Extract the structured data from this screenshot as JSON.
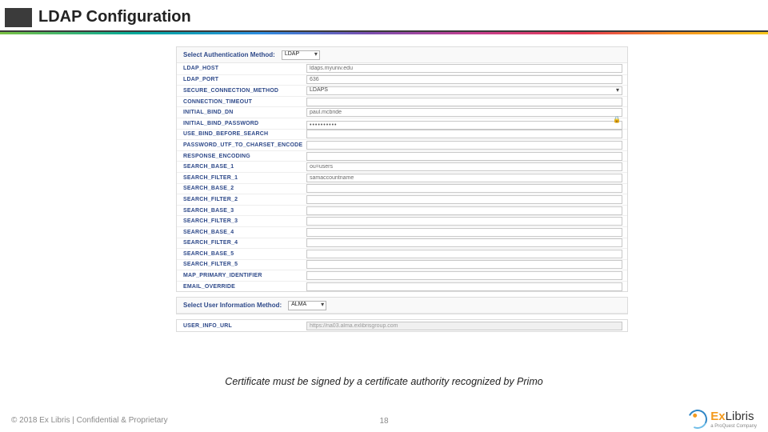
{
  "header": {
    "title": "LDAP Configuration"
  },
  "authMethod": {
    "label": "Select Authentication Method:",
    "value": "LDAP"
  },
  "rows": [
    {
      "label": "LDAP_HOST",
      "type": "text",
      "value": "ldaps.myuniv.edu"
    },
    {
      "label": "LDAP_PORT",
      "type": "text",
      "value": "636"
    },
    {
      "label": "SECURE_CONNECTION_METHOD",
      "type": "select",
      "value": "LDAPS"
    },
    {
      "label": "CONNECTION_TIMEOUT",
      "type": "text",
      "value": ""
    },
    {
      "label": "INITIAL_BIND_DN",
      "type": "text",
      "value": "paul.mcbride"
    },
    {
      "label": "INITIAL_BIND_PASSWORD",
      "type": "password",
      "value": "••••••••••"
    },
    {
      "label": "USE_BIND_BEFORE_SEARCH",
      "type": "text",
      "value": ""
    },
    {
      "label": "PASSWORD_UTF_TO_CHARSET_ENCODE",
      "type": "text",
      "value": ""
    },
    {
      "label": "RESPONSE_ENCODING",
      "type": "text",
      "value": ""
    },
    {
      "label": "SEARCH_BASE_1",
      "type": "text",
      "value": "ou=users"
    },
    {
      "label": "SEARCH_FILTER_1",
      "type": "text",
      "value": "samaccountname"
    },
    {
      "label": "SEARCH_BASE_2",
      "type": "text",
      "value": ""
    },
    {
      "label": "SEARCH_FILTER_2",
      "type": "text",
      "value": ""
    },
    {
      "label": "SEARCH_BASE_3",
      "type": "text",
      "value": ""
    },
    {
      "label": "SEARCH_FILTER_3",
      "type": "text",
      "value": ""
    },
    {
      "label": "SEARCH_BASE_4",
      "type": "text",
      "value": ""
    },
    {
      "label": "SEARCH_FILTER_4",
      "type": "text",
      "value": ""
    },
    {
      "label": "SEARCH_BASE_5",
      "type": "text",
      "value": ""
    },
    {
      "label": "SEARCH_FILTER_5",
      "type": "text",
      "value": ""
    },
    {
      "label": "MAP_PRIMARY_IDENTIFIER",
      "type": "text",
      "value": ""
    },
    {
      "label": "EMAIL_OVERRIDE",
      "type": "text",
      "value": ""
    }
  ],
  "userInfoMethod": {
    "label": "Select User Information Method:",
    "value": "ALMA"
  },
  "userInfoRow": {
    "label": "USER_INFO_URL",
    "value": "https://na03.alma.exlibrisgroup.com"
  },
  "caption": "Certificate must be signed by a certificate authority recognized by Primo",
  "footer": {
    "copyright": "© 2018 Ex Libris | Confidential & Proprietary",
    "page": "18"
  },
  "logo": {
    "brand_prefix": "Ex",
    "brand_suffix": "Libris",
    "tagline": "a ProQuest Company"
  }
}
